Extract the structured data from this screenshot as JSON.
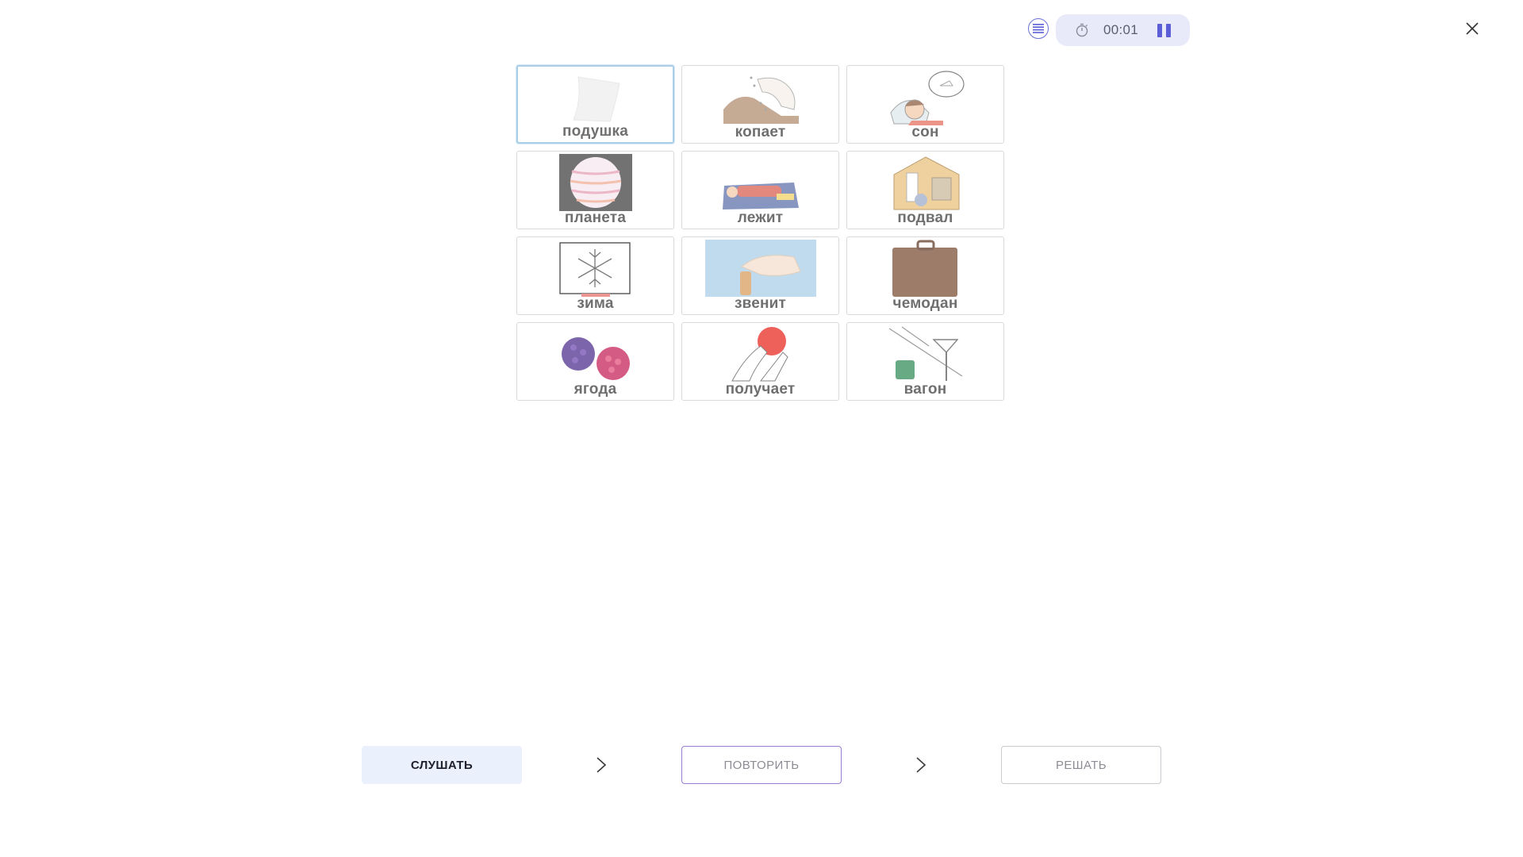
{
  "timer": {
    "time": "00:01"
  },
  "cards": [
    {
      "word": "подушка",
      "icon": "pillow-icon"
    },
    {
      "word": "копает",
      "icon": "digging-hand-icon"
    },
    {
      "word": "сон",
      "icon": "sleeping-child-icon"
    },
    {
      "word": "планета",
      "icon": "planet-icon"
    },
    {
      "word": "лежит",
      "icon": "lying-person-icon"
    },
    {
      "word": "подвал",
      "icon": "basement-icon"
    },
    {
      "word": "зима",
      "icon": "snowflake-icon"
    },
    {
      "word": "звенит",
      "icon": "ringing-bell-icon"
    },
    {
      "word": "чемодан",
      "icon": "suitcase-icon"
    },
    {
      "word": "ягода",
      "icon": "berries-icon"
    },
    {
      "word": "получает",
      "icon": "receiving-ball-icon"
    },
    {
      "word": "вагон",
      "icon": "cable-car-icon"
    }
  ],
  "actions": {
    "listen": "СЛУШАТЬ",
    "repeat": "ПОВТОРИТЬ",
    "solve": "РЕШАТЬ"
  },
  "colors": {
    "accent": "#5b5ed6",
    "timer_bg": "#e8eaf9",
    "listen_bg": "#eaf1fc",
    "active_card_border": "#a9cfe8"
  }
}
